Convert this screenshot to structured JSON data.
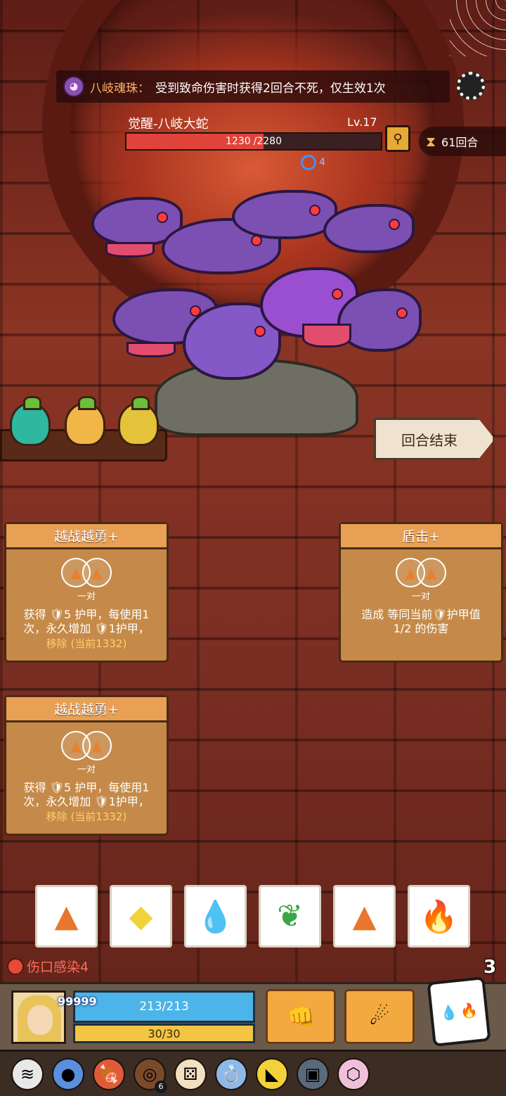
{
  "relic_banner": {
    "name": "八岐魂珠：",
    "description": "受到致命伤害时获得2回合不死，仅生效1次"
  },
  "boss": {
    "name": "觉醒-八岐大蛇",
    "level": "Lv.17",
    "hp_current": "1230",
    "hp_max_label": "/2280",
    "hp_fraction": 0.54,
    "status_value": "4"
  },
  "turns_label": "61回合",
  "end_turn_label": "回合结束",
  "cards": [
    {
      "title": "越战越勇+",
      "pair_label": "一对",
      "body_line1": "获得 🛡5 护甲，每使用1",
      "body_line2": "次，永久增加 🛡1护甲，",
      "remove_label": "移除",
      "current_label": "(当前1332)"
    },
    {
      "title": "盾击+",
      "pair_label": "一对",
      "body_line1": "造成 等同当前🛡护甲值",
      "body_line2": "1/2 的伤害",
      "remove_label": "",
      "current_label": ""
    },
    {
      "title": "越战越勇+",
      "pair_label": "一对",
      "body_line1": "获得 🛡5 护甲，每使用1",
      "body_line2": "次，永久增加 🛡1护甲，",
      "remove_label": "移除",
      "current_label": "(当前1332)"
    }
  ],
  "dice": [
    {
      "icon": "earth-icon",
      "glyph": "▲",
      "color": "#e8762e"
    },
    {
      "icon": "lightning-icon",
      "glyph": "◆",
      "color": "#f2d23a"
    },
    {
      "icon": "water-icon",
      "glyph": "💧",
      "color": "#2d5fd4"
    },
    {
      "icon": "wind-icon",
      "glyph": "❦",
      "color": "#3aa646"
    },
    {
      "icon": "earth-icon",
      "glyph": "▲",
      "color": "#e8762e"
    },
    {
      "icon": "fire-icon",
      "glyph": "🔥",
      "color": "#e83a2a"
    }
  ],
  "debuff_label": "伤口感染4",
  "player": {
    "armor": "99999",
    "hp": "213/213",
    "energy": "30/30"
  },
  "reroll_count": "3",
  "relic_count": "6",
  "colors": {
    "accent": "#e8a055",
    "hp_bar": "#4cb4e8",
    "energy_bar": "#f2c544",
    "boss_hp": "#e0433a"
  }
}
